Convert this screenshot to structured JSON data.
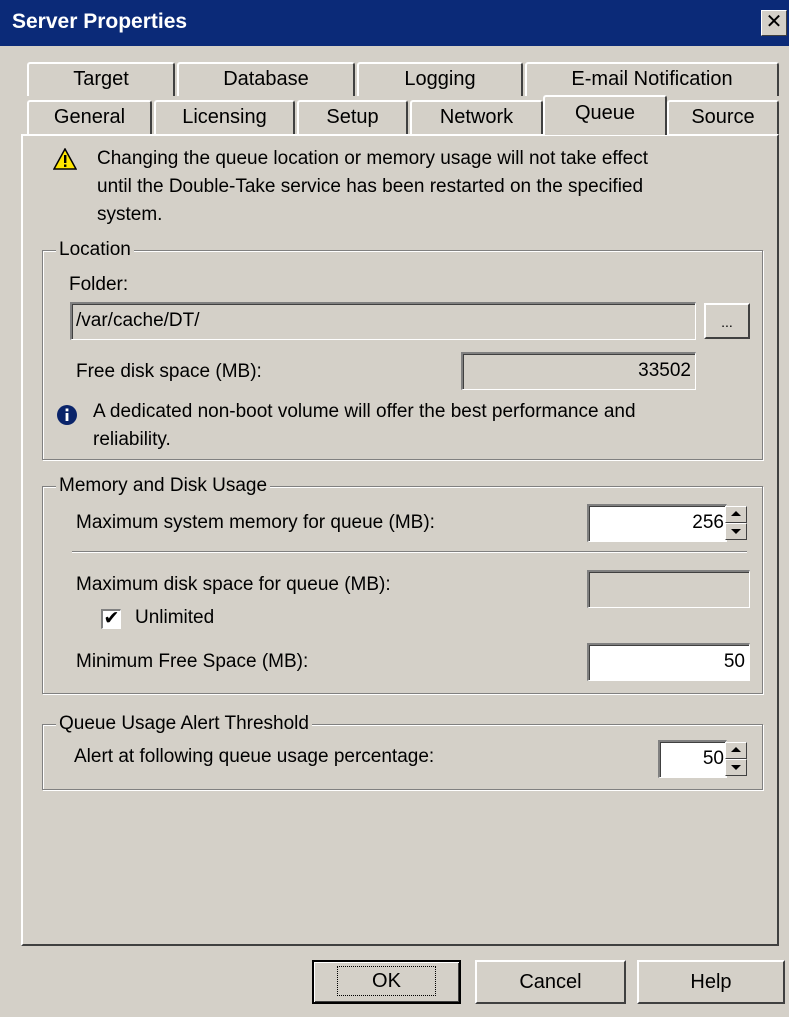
{
  "window": {
    "title": "Server Properties",
    "close_label": "✕"
  },
  "tabs_row1": [
    {
      "label": "Target"
    },
    {
      "label": "Database"
    },
    {
      "label": "Logging"
    },
    {
      "label": "E-mail Notification"
    }
  ],
  "tabs_row2": [
    {
      "label": "General"
    },
    {
      "label": "Licensing"
    },
    {
      "label": "Setup"
    },
    {
      "label": "Network"
    },
    {
      "label": "Queue",
      "active": true
    },
    {
      "label": "Source"
    }
  ],
  "warning": {
    "icon": "warning-icon",
    "line1": "Changing the queue location or memory usage will not take effect",
    "line2": "until the Double-Take service has been restarted on the specified",
    "line3": "system."
  },
  "location": {
    "group_label": "Location",
    "folder_label": "Folder:",
    "folder_value": "/var/cache/DT/",
    "browse_label": "...",
    "free_space_label": "Free disk space (MB):",
    "free_space_value": "33502",
    "info_icon": "info-icon",
    "info_line1": "A dedicated non-boot volume will offer the best performance and",
    "info_line2": "reliability."
  },
  "memory": {
    "group_label": "Memory and Disk Usage",
    "max_memory_label": "Maximum system memory for queue (MB):",
    "max_memory_value": "256",
    "max_disk_label": "Maximum disk space for queue (MB):",
    "max_disk_value": "",
    "unlimited_label": "Unlimited",
    "unlimited_checked": true,
    "min_free_label": "Minimum Free Space (MB):",
    "min_free_value": "50"
  },
  "alert": {
    "group_label": "Queue Usage Alert Threshold",
    "label": "Alert at following queue usage percentage:",
    "value": "50"
  },
  "buttons": {
    "ok": "OK",
    "cancel": "Cancel",
    "help": "Help"
  }
}
